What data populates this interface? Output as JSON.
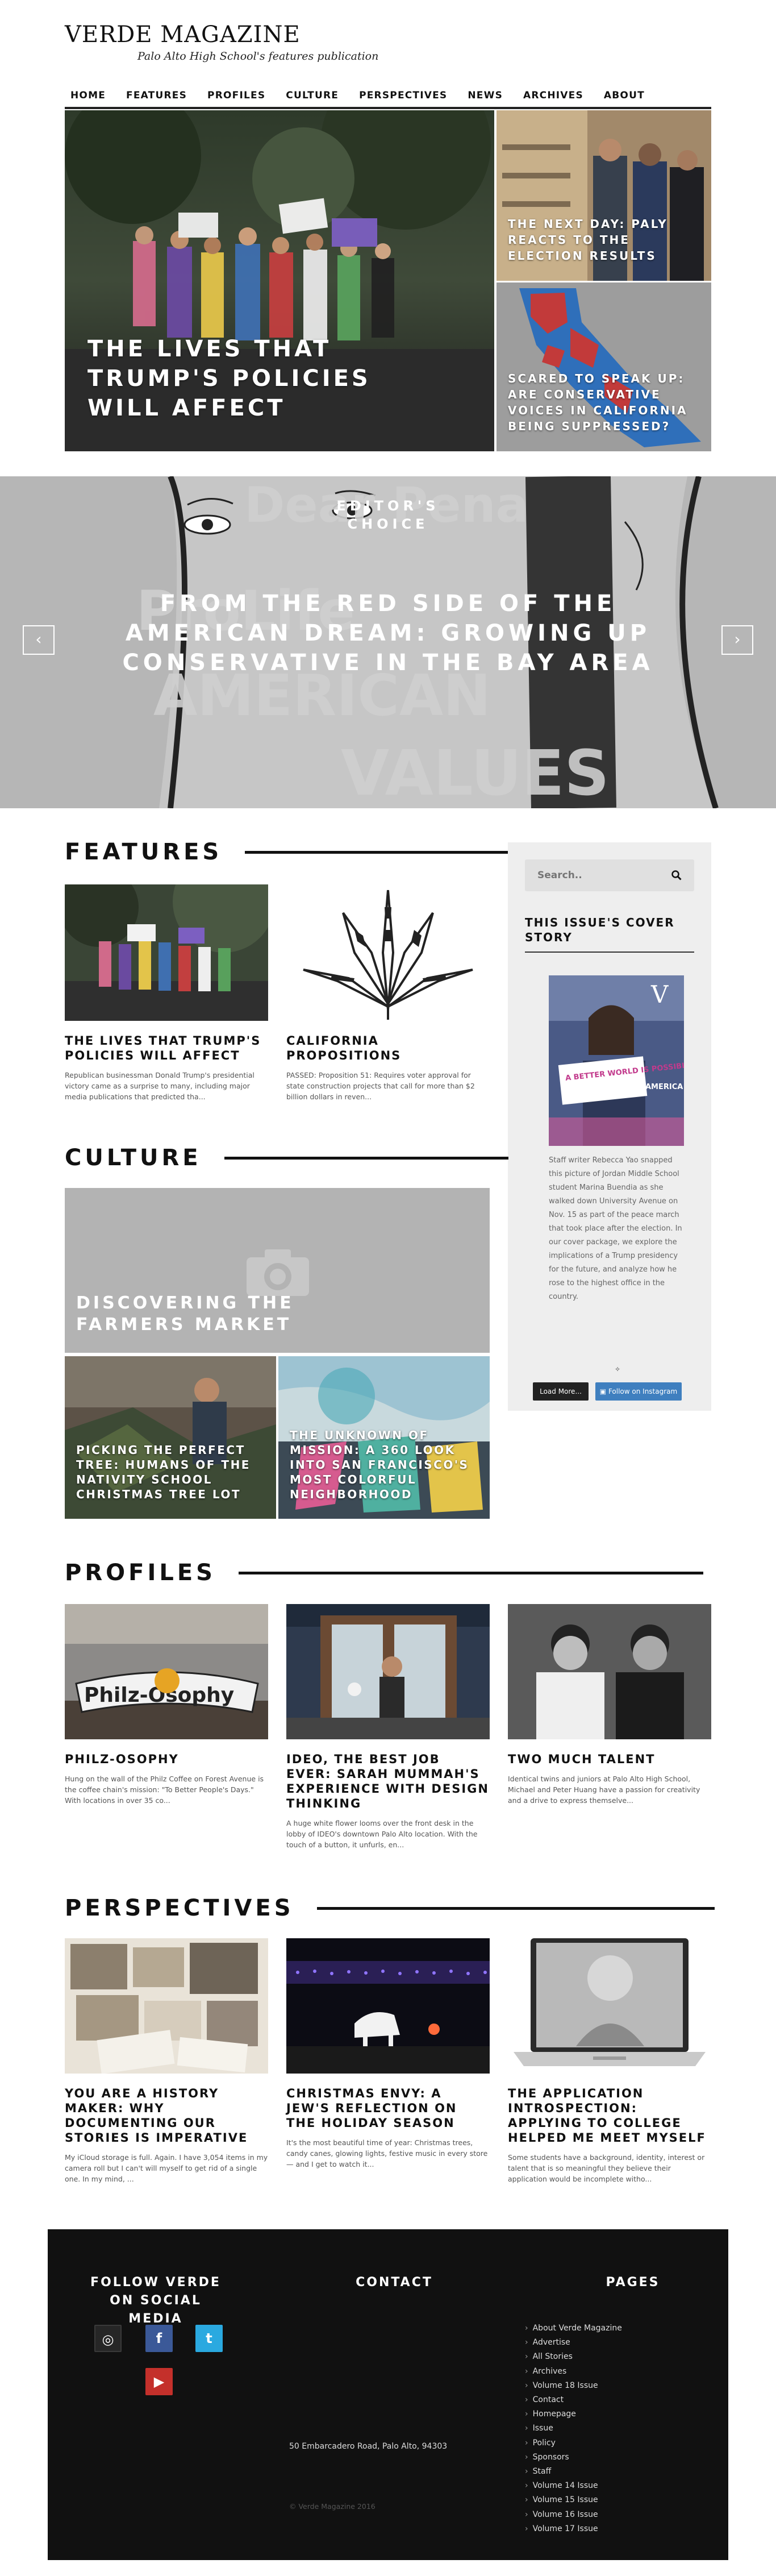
{
  "header": {
    "title": "VERDE MAGAZINE",
    "tagline": "Palo Alto High School's features publication"
  },
  "nav": {
    "items": [
      "HOME",
      "FEATURES",
      "PROFILES",
      "CULTURE",
      "PERSPECTIVES",
      "NEWS",
      "ARCHIVES",
      "ABOUT"
    ]
  },
  "hero": {
    "main": "THE LIVES THAT TRUMP'S POLICIES WILL AFFECT",
    "side1": "THE NEXT DAY: PALY REACTS TO THE ELECTION RESULTS",
    "side2": "SCARED TO SPEAK UP: ARE CONSERVATIVE VOICES IN CALIFORNIA BEING SUPPRESSED?"
  },
  "slider": {
    "kicker": "EDITOR'S CHOICE",
    "headline": "FROM THE RED SIDE OF THE AMERICAN DREAM: GROWING UP CONSERVATIVE IN THE BAY AREA",
    "bg_words": [
      "Dear Pena",
      "ProLife",
      "AMERICAN",
      "VALUES"
    ],
    "prev": "‹",
    "next": "›"
  },
  "features": {
    "heading": "FEATURES",
    "cards": [
      {
        "title": "THE LIVES THAT TRUMP'S POLICIES WILL AFFECT",
        "excerpt": "Republican businessman Donald Trump's presidential victory came as a surprise to many, including major media publications that predicted tha..."
      },
      {
        "title": "CALIFORNIA PROPOSITIONS",
        "excerpt": "PASSED: Proposition 51: Requires voter approval for state construction projects that call for more than $2 billion dollars in reven..."
      }
    ]
  },
  "sidebar": {
    "search_placeholder": "Search..",
    "cover_title": "THIS ISSUE'S COVER STORY",
    "cover_text": "Staff writer Rebecca Yao snapped this picture of Jordan Middle School student Marina Buendia as she walked down University Avenue on Nov. 15 as part of the peace march that took place after the election. In our cover package, we explore the implications of a Trump presidency for the future, and analyze how he rose to the highest office in the country.",
    "cover_sign": "A BETTER WORLD IS POSSIBLE",
    "cover_v": "V",
    "cover_side": "AMERICA",
    "load_more": "Load More...",
    "follow_instagram": "Follow on Instagram"
  },
  "culture": {
    "heading": "CULTURE",
    "main": "DISCOVERING THE FARMERS MARKET",
    "sub1": "PICKING THE PERFECT TREE: HUMANS OF THE NATIVITY SCHOOL CHRISTMAS TREE LOT",
    "sub2": "THE UNKNOWN OF MISSION: A 360 LOOK INTO SAN FRANCISCO'S MOST COLORFUL NEIGHBORHOOD"
  },
  "profiles": {
    "heading": "PROFILES",
    "cards": [
      {
        "title": "PHILZ-OSOPHY",
        "excerpt": "Hung on the wall of the Philz Coffee on Forest Avenue is the coffee chain's mission: \"To Better People's Days.\" With locations in over 35 co..."
      },
      {
        "title": "IDEO, THE BEST JOB EVER: SARAH MUMMAH'S EXPERIENCE WITH DESIGN THINKING",
        "excerpt": "A huge white flower looms over the front desk in the lobby of IDEO's downtown Palo Alto location. With the touch of a button, it unfurls, en..."
      },
      {
        "title": "TWO MUCH TALENT",
        "excerpt": "Identical twins and juniors at Palo Alto High School, Michael and Peter Huang have a passion for creativity and a drive to express themselve..."
      }
    ],
    "philz_sign": "Philz-Osophy"
  },
  "perspectives": {
    "heading": "PERSPECTIVES",
    "cards": [
      {
        "title": "YOU ARE A HISTORY MAKER: WHY DOCUMENTING OUR STORIES IS IMPERATIVE",
        "excerpt": "My iCloud storage is full. Again. I have 3,054 items in my camera roll but I can't will myself to get rid of a single one. In my mind, ..."
      },
      {
        "title": "CHRISTMAS ENVY: A JEW'S REFLECTION ON THE HOLIDAY SEASON",
        "excerpt": "It's the most beautiful time of year: Christmas trees, candy canes, glowing lights, festive music in every store — and I get to watch it..."
      },
      {
        "title": "THE APPLICATION INTROSPECTION: APPLYING TO COLLEGE HELPED ME MEET MYSELF",
        "excerpt": "Some students have a background, identity, interest or talent that is so meaningful they believe their application would be incomplete witho..."
      }
    ]
  },
  "footer": {
    "follow_heading": "FOLLOW VERDE ON SOCIAL MEDIA",
    "contact_heading": "CONTACT",
    "pages_heading": "PAGES",
    "address": "50 Embarcadero Road, Palo Alto, 94303",
    "copyright": "© Verde Magazine 2016",
    "social": {
      "facebook": "f",
      "twitter": "t",
      "youtube": "▶"
    },
    "pages": [
      "About Verde Magazine",
      "Advertise",
      "All Stories",
      "Archives",
      "Volume 18 Issue",
      "Contact",
      "Homepage",
      "Issue",
      "Policy",
      "Sponsors",
      "Staff",
      "Volume 14 Issue",
      "Volume 15 Issue",
      "Volume 16 Issue",
      "Volume 17 Issue"
    ]
  }
}
